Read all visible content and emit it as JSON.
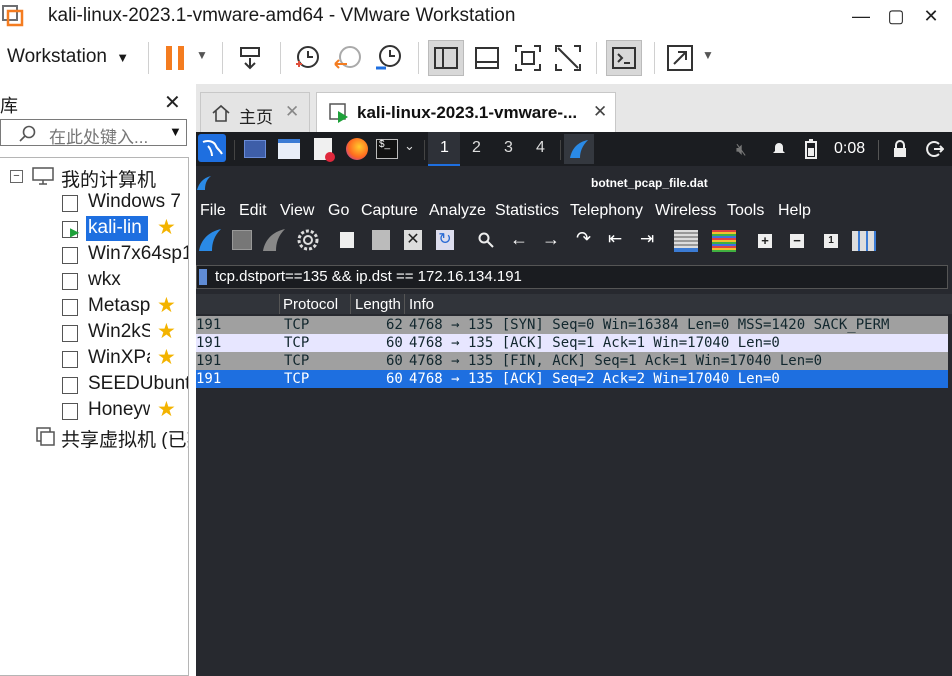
{
  "window": {
    "title": "kali-linux-2023.1-vmware-amd64 - VMware Workstation",
    "minimize": "—",
    "maximize": "▢",
    "close": "✕"
  },
  "toolbar": {
    "menu_label": "Workstation",
    "icons": [
      "pause-icon",
      "send-keys-icon",
      "snapshot-icon",
      "revert-snapshot-icon",
      "snapshot-manager-icon",
      "show-library-icon",
      "thumbnail-icon",
      "fullscreen-icon",
      "unity-icon",
      "console-icon",
      "stretch-icon"
    ]
  },
  "library": {
    "title": "库",
    "close": "✕",
    "search_placeholder": "在此处键入...",
    "root": "我的计算机",
    "items": [
      {
        "label": "Windows 7",
        "favorite": false
      },
      {
        "label": "kali-lin",
        "favorite": true,
        "selected": true,
        "running": true
      },
      {
        "label": "Win7x64sp1",
        "favorite": false
      },
      {
        "label": "wkx",
        "favorite": false
      },
      {
        "label": "Metasp",
        "favorite": true
      },
      {
        "label": "Win2kS",
        "favorite": true
      },
      {
        "label": "WinXPa",
        "favorite": true
      },
      {
        "label": "SEEDUbuntu",
        "favorite": false
      },
      {
        "label": "Honeyw",
        "favorite": true
      }
    ],
    "shared": "共享虚拟机 (已弃"
  },
  "tabs": [
    {
      "label": "主页",
      "close": "✕"
    },
    {
      "label": "kali-linux-2023.1-vmware-...",
      "close": "✕",
      "active": true
    }
  ],
  "kali_panel": {
    "workspaces": [
      "1",
      "2",
      "3",
      "4"
    ],
    "active_workspace": "1",
    "clock": "0:08"
  },
  "wireshark": {
    "window_title": "botnet_pcap_file.dat",
    "menus": [
      "File",
      "Edit",
      "View",
      "Go",
      "Capture",
      "Analyze",
      "Statistics",
      "Telephony",
      "Wireless",
      "Tools",
      "Help"
    ],
    "filter": "tcp.dstport==135 && ip.dst == 172.16.134.191",
    "columns": [
      "Protocol",
      "Length",
      "Info"
    ],
    "rows": [
      {
        "dest": "191",
        "protocol": "TCP",
        "length": "62",
        "info": "4768 → 135 [SYN] Seq=0 Win=16384 Len=0 MSS=1420 SACK_PERM",
        "bg": "#a0a0a0",
        "fg": "#12272e"
      },
      {
        "dest": "191",
        "protocol": "TCP",
        "length": "60",
        "info": "4768 → 135 [ACK] Seq=1 Ack=1 Win=17040 Len=0",
        "bg": "#e7e6ff",
        "fg": "#12272e"
      },
      {
        "dest": "191",
        "protocol": "TCP",
        "length": "60",
        "info": "4768 → 135 [FIN, ACK] Seq=1 Ack=1 Win=17040 Len=0",
        "bg": "#a0a0a0",
        "fg": "#12272e"
      },
      {
        "dest": "191",
        "protocol": "TCP",
        "length": "60",
        "info": "4768 → 135 [ACK] Seq=2 Ack=2 Win=17040 Len=0",
        "bg": "#1e6fe0",
        "fg": "#ffffff",
        "selected": true
      }
    ]
  },
  "colors": {
    "accent": "#1e6fe0",
    "vmware_orange": "#f47c20",
    "kali_dark": "#27292f",
    "star": "#f3b300"
  }
}
